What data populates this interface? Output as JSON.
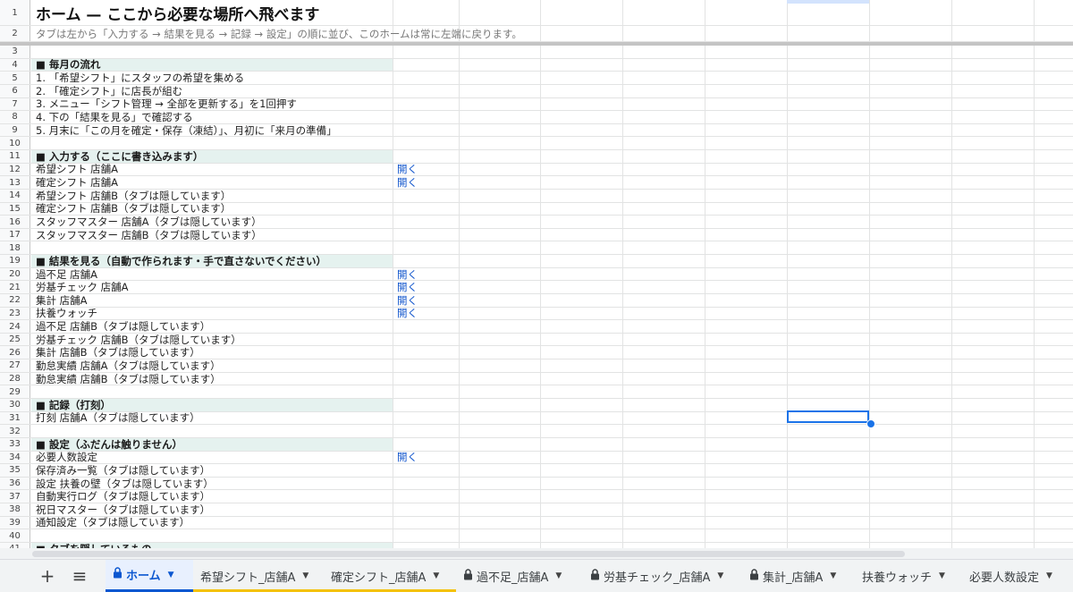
{
  "sheet": {
    "title": "ホーム — ここから必要な場所へ飛べます",
    "subtitle": "タブは左から「入力する → 結果を見る → 記録 → 設定」の順に並び、このホームは常に左端に戻ります。",
    "link_label": "開く",
    "rows": [
      {
        "n": "3",
        "text": "",
        "type": "blank"
      },
      {
        "n": "4",
        "text": "■ 毎月の流れ",
        "type": "section"
      },
      {
        "n": "5",
        "text": "1. 「希望シフト」にスタッフの希望を集める",
        "type": "text"
      },
      {
        "n": "6",
        "text": "2. 「確定シフト」に店長が組む",
        "type": "text"
      },
      {
        "n": "7",
        "text": "3. メニュー「シフト管理 → 全部を更新する」を1回押す",
        "type": "text"
      },
      {
        "n": "8",
        "text": "4. 下の「結果を見る」で確認する",
        "type": "text"
      },
      {
        "n": "9",
        "text": "5. 月末に「この月を確定・保存（凍結）」、月初に「来月の準備」",
        "type": "text"
      },
      {
        "n": "10",
        "text": "",
        "type": "blank"
      },
      {
        "n": "11",
        "text": "■ 入力する（ここに書き込みます）",
        "type": "section"
      },
      {
        "n": "12",
        "text": "希望シフト 店舗A",
        "type": "text",
        "link": true
      },
      {
        "n": "13",
        "text": "確定シフト 店舗A",
        "type": "text",
        "link": true
      },
      {
        "n": "14",
        "text": "希望シフト 店舗B（タブは隠しています）",
        "type": "text"
      },
      {
        "n": "15",
        "text": "確定シフト 店舗B（タブは隠しています）",
        "type": "text"
      },
      {
        "n": "16",
        "text": "スタッフマスター 店舗A（タブは隠しています）",
        "type": "text"
      },
      {
        "n": "17",
        "text": "スタッフマスター 店舗B（タブは隠しています）",
        "type": "text"
      },
      {
        "n": "18",
        "text": "",
        "type": "blank"
      },
      {
        "n": "19",
        "text": "■ 結果を見る（自動で作られます・手で直さないでください）",
        "type": "section"
      },
      {
        "n": "20",
        "text": "過不足 店舗A",
        "type": "text",
        "link": true
      },
      {
        "n": "21",
        "text": "労基チェック 店舗A",
        "type": "text",
        "link": true
      },
      {
        "n": "22",
        "text": "集計 店舗A",
        "type": "text",
        "link": true
      },
      {
        "n": "23",
        "text": "扶養ウォッチ",
        "type": "text",
        "link": true
      },
      {
        "n": "24",
        "text": "過不足 店舗B（タブは隠しています）",
        "type": "text"
      },
      {
        "n": "25",
        "text": "労基チェック 店舗B（タブは隠しています）",
        "type": "text"
      },
      {
        "n": "26",
        "text": "集計 店舗B（タブは隠しています）",
        "type": "text"
      },
      {
        "n": "27",
        "text": "勤怠実績 店舗A（タブは隠しています）",
        "type": "text"
      },
      {
        "n": "28",
        "text": "勤怠実績 店舗B（タブは隠しています）",
        "type": "text"
      },
      {
        "n": "29",
        "text": "",
        "type": "blank"
      },
      {
        "n": "30",
        "text": "■ 記録（打刻）",
        "type": "section"
      },
      {
        "n": "31",
        "text": "打刻 店舗A（タブは隠しています）",
        "type": "text"
      },
      {
        "n": "32",
        "text": "",
        "type": "blank"
      },
      {
        "n": "33",
        "text": "■ 設定（ふだんは触りません）",
        "type": "section"
      },
      {
        "n": "34",
        "text": "必要人数設定",
        "type": "text",
        "link": true
      },
      {
        "n": "35",
        "text": "保存済み一覧（タブは隠しています）",
        "type": "text"
      },
      {
        "n": "36",
        "text": "設定 扶養の壁（タブは隠しています）",
        "type": "text"
      },
      {
        "n": "37",
        "text": "自動実行ログ（タブは隠しています）",
        "type": "text"
      },
      {
        "n": "38",
        "text": "祝日マスター（タブは隠しています）",
        "type": "text"
      },
      {
        "n": "39",
        "text": "通知設定（タブは隠しています）",
        "type": "text"
      },
      {
        "n": "40",
        "text": "",
        "type": "blank"
      },
      {
        "n": "41",
        "text": "■ タブを隠しているもの",
        "type": "section"
      }
    ]
  },
  "tabs": [
    {
      "label": "ホーム",
      "locked": true,
      "active": true,
      "color": ""
    },
    {
      "label": "希望シフト_店舗A",
      "locked": false,
      "active": false,
      "color": "#f4c20d"
    },
    {
      "label": "確定シフト_店舗A",
      "locked": false,
      "active": false,
      "color": "#f4c20d"
    },
    {
      "label": "過不足_店舗A",
      "locked": true,
      "active": false,
      "color": ""
    },
    {
      "label": "労基チェック_店舗A",
      "locked": true,
      "active": false,
      "color": ""
    },
    {
      "label": "集計_店舗A",
      "locked": true,
      "active": false,
      "color": ""
    },
    {
      "label": "扶養ウォッチ",
      "locked": false,
      "active": false,
      "color": ""
    },
    {
      "label": "必要人数設定",
      "locked": false,
      "active": false,
      "color": ""
    }
  ],
  "icons": {
    "add_sheet": "plus-icon",
    "all_sheets": "menu-icon",
    "lock": "lock-icon",
    "dropdown": "caret-down-icon"
  },
  "colors": {
    "section_bg": "#e5f2ef",
    "link": "#1155cc",
    "active_tab": "#0b57d0",
    "input_tab": "#f4c20d"
  }
}
